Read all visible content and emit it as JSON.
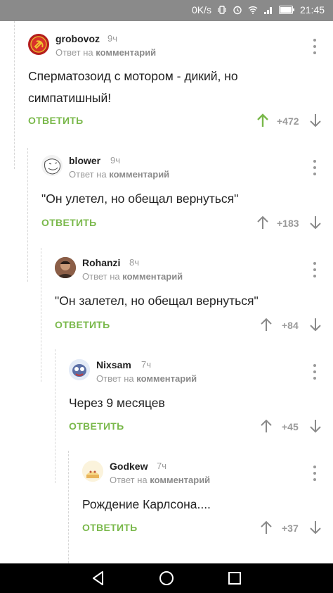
{
  "status": {
    "speed": "0K/s",
    "time": "21:45",
    "icons": [
      "vibrate-icon",
      "alarm-icon",
      "wifi-icon",
      "signal-icon",
      "battery-icon"
    ]
  },
  "colors": {
    "accent": "#79b84a",
    "upvote_active": "#79b84a",
    "muted": "#9a9a9a"
  },
  "reply_label": "ОТВЕТИТЬ",
  "comments": [
    {
      "author": "grobovoz",
      "time": "9ч",
      "reply_prefix": "Ответ на",
      "reply_target": "комментарий",
      "text_lines": [
        "Сперматозоид с мотором - дикий, но",
        "симпатишный!"
      ],
      "rating": "+472",
      "avatar": "soviet-emblem"
    },
    {
      "author": "blower",
      "time": "9ч",
      "reply_prefix": "Ответ на",
      "reply_target": "комментарий",
      "text_lines": [
        "\"Он улетел, но обещал вернуться\""
      ],
      "rating": "+183",
      "avatar": "troll-face"
    },
    {
      "author": "Rohanzi",
      "time": "8ч",
      "reply_prefix": "Ответ на",
      "reply_target": "комментарий",
      "text_lines": [
        "\"Он залетел, но обещал вернуться\""
      ],
      "rating": "+84",
      "avatar": "portrait"
    },
    {
      "author": "Nixsam",
      "time": "7ч",
      "reply_prefix": "Ответ на",
      "reply_target": "комментарий",
      "text_lines": [
        "Через 9 месяцев"
      ],
      "rating": "+45",
      "avatar": "cartoon"
    },
    {
      "author": "Godkew",
      "time": "7ч",
      "reply_prefix": "Ответ на",
      "reply_target": "комментарий",
      "text_lines": [
        "Рождение Карлсона...."
      ],
      "rating": "+37",
      "avatar": "cake"
    }
  ],
  "navbar": {
    "buttons": [
      "back-icon",
      "home-icon",
      "recents-icon"
    ]
  }
}
